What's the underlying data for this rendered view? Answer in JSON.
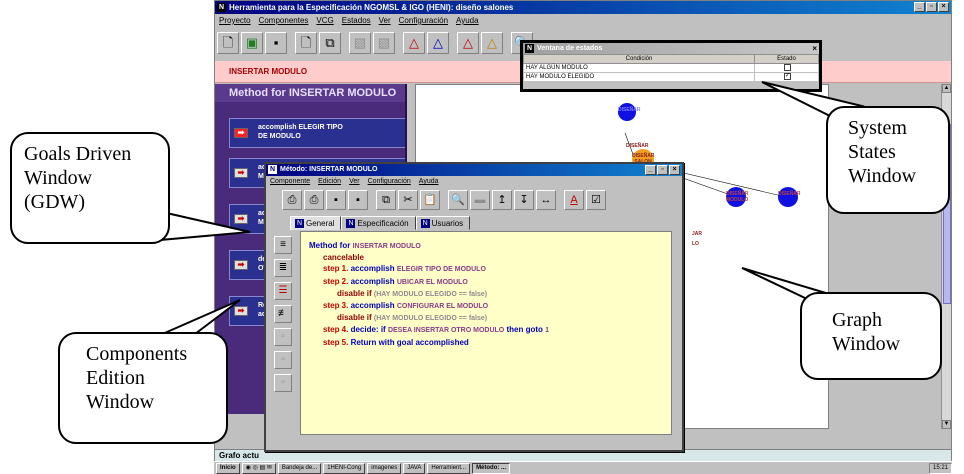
{
  "app": {
    "title": "Herramienta para la Especificación NGOMSL & IGO (HENI): diseño salones",
    "menu": [
      "Proyecto",
      "Componentes",
      "VCG",
      "Estados",
      "Ver",
      "Configuración",
      "Ayuda"
    ],
    "subheader": "INSERTAR MODULO",
    "status": "Grafo actu"
  },
  "gdw": {
    "title": "Method for INSERTAR MODULO",
    "steps": [
      {
        "line1": "accomplish ELEGIR TIPO",
        "line2": "DE MODULO"
      },
      {
        "line1": "acc",
        "line2": "MO"
      },
      {
        "line1": "acc",
        "line2": "MO"
      },
      {
        "line1": "dec",
        "line2": "OTR"
      },
      {
        "line1": "Ret",
        "line2": "acc"
      }
    ]
  },
  "graph": {
    "nodes": [
      "DISEÑAR",
      "DISEÑAR SALON",
      "DISEÑAR MODULO",
      "DISEÑAR",
      "ELEGIR",
      "PRIMER",
      "MODULO"
    ],
    "labels": [
      "DISEÑAR",
      "SALO",
      "JAR",
      "LO"
    ]
  },
  "states_window": {
    "title": "Ventana de estados",
    "headers": [
      "Condición",
      "Estado"
    ],
    "rows": [
      {
        "condition": "HAY ALGÚN MODULO",
        "checked": false
      },
      {
        "condition": "HAY MODULO ELEGIDO",
        "checked": true
      }
    ]
  },
  "method_window": {
    "title": "Método: INSERTAR MODULO",
    "menu": [
      "Componente",
      "Edición",
      "Ver",
      "Configuración",
      "Ayuda"
    ],
    "tabs": [
      "General",
      "Especificación",
      "Usuarios"
    ],
    "code": {
      "method_kw": "Method for",
      "method_name": "INSERTAR MODULO",
      "cancelable": "cancelable",
      "step1_label": "step 1.",
      "step1_kw": "accomplish",
      "step1_arg": "ELEGIR TIPO DE MODULO",
      "step2_label": "step 2.",
      "step2_kw": "accomplish",
      "step2_arg": "UBICAR EL MODULO",
      "disable_kw": "disable if",
      "disable1_cond": "(HAY MODULO ELEGIDO == false)",
      "step3_label": "step 3.",
      "step3_kw": "accomplish",
      "step3_arg": "CONFIGURAR EL MODULO",
      "disable2_cond": "(HAY MODULO ELEGIDO == false)",
      "step4_label": "step 4.",
      "step4_kw1": "decide:",
      "step4_kw2": "if",
      "step4_cond": "DESEA INSERTAR OTRO MODULO",
      "step4_kw3": "then goto",
      "step4_target": "1",
      "step5_label": "step 5.",
      "step5_text": "Return with goal accomplished"
    }
  },
  "taskbar": {
    "items": [
      "Inicio",
      "Bandeja de...",
      "1HENI-Cong",
      "imagenes",
      "JAVA",
      "Herramient...",
      "Método: ..."
    ],
    "clock": "15:21"
  },
  "callouts": {
    "gdw": [
      "Goals Driven",
      "Window",
      "(GDW)"
    ],
    "states": [
      "System",
      "States",
      "Window"
    ],
    "graph": [
      "Graph",
      "Window"
    ],
    "components": [
      "Components",
      "Edition",
      "Window"
    ]
  }
}
